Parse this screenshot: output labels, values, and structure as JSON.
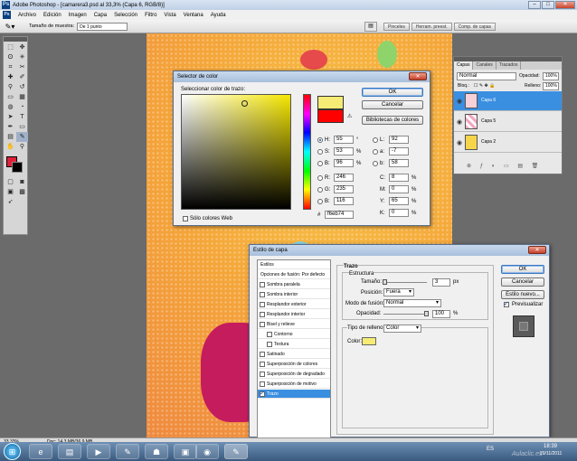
{
  "window": {
    "title": "Adobe Photoshop - [camarera3.psd al 33,3% (Capa 6, RGB/8)]",
    "app_icon_letters": "Ps"
  },
  "menu": [
    "Archivo",
    "Edición",
    "Imagen",
    "Capa",
    "Selección",
    "Filtro",
    "Vista",
    "Ventana",
    "Ayuda"
  ],
  "options_bar": {
    "sample_label": "Tamaño de muestra:",
    "sample_value": "De 1 punto",
    "palette_tabs": [
      "Pinceles",
      "Herram. preest.",
      "Comp. de capas"
    ]
  },
  "color_picker": {
    "title": "Selector de color",
    "heading": "Seleccionar color de trazo:",
    "ok": "OK",
    "cancel": "Cancelar",
    "libraries": "Bibliotecas de colores",
    "web_only": "Sólo colores Web",
    "new_color": "#f6eb74",
    "old_color": "#ff0000",
    "H_label": "H:",
    "H": "55",
    "H_unit": "°",
    "S_label": "S:",
    "S": "53",
    "S_unit": "%",
    "B_label": "B:",
    "B": "96",
    "B_unit": "%",
    "R_label": "R:",
    "R": "246",
    "G_label": "G:",
    "G": "235",
    "Bb_label": "B:",
    "Bb": "116",
    "L_label": "L:",
    "L": "92",
    "a_label": "a:",
    "a": "-7",
    "b_label": "b:",
    "b": "58",
    "C_label": "C:",
    "C": "8",
    "M_label": "M:",
    "M": "0",
    "Y_label": "Y:",
    "Y": "65",
    "K_label": "K:",
    "K": "0",
    "pct": "%",
    "hash": "#",
    "hex": "f6eb74"
  },
  "layers_panel": {
    "tabs": [
      "Capas",
      "Canales",
      "Trazados"
    ],
    "blend_mode": "Normal",
    "opacity_label": "Opacidad:",
    "opacity": "100%",
    "lock_label": "Bloq.:",
    "fill_label": "Relleno:",
    "fill": "100%",
    "layers": [
      {
        "name": "Capa 6",
        "selected": true
      },
      {
        "name": "Capa 5",
        "selected": false
      },
      {
        "name": "Capa 2",
        "selected": false
      }
    ]
  },
  "layer_style": {
    "title": "Estilo de capa",
    "list": [
      {
        "label": "Estilos",
        "checkbox": false,
        "checked": false,
        "selected": false
      },
      {
        "label": "Opciones de fusión: Por defecto",
        "checkbox": false,
        "checked": false,
        "selected": false
      },
      {
        "label": "Sombra paralela",
        "checkbox": true,
        "checked": false,
        "selected": false
      },
      {
        "label": "Sombra interior",
        "checkbox": true,
        "checked": false,
        "selected": false
      },
      {
        "label": "Resplandor exterior",
        "checkbox": true,
        "checked": false,
        "selected": false
      },
      {
        "label": "Resplandor interior",
        "checkbox": true,
        "checked": false,
        "selected": false
      },
      {
        "label": "Bisel y relieve",
        "checkbox": true,
        "checked": false,
        "selected": false
      },
      {
        "label": "Contorno",
        "checkbox": true,
        "checked": false,
        "selected": false
      },
      {
        "label": "Textura",
        "checkbox": true,
        "checked": false,
        "selected": false
      },
      {
        "label": "Satinado",
        "checkbox": true,
        "checked": false,
        "selected": false
      },
      {
        "label": "Superposición de colores",
        "checkbox": true,
        "checked": false,
        "selected": false
      },
      {
        "label": "Superposición de degradado",
        "checkbox": true,
        "checked": false,
        "selected": false
      },
      {
        "label": "Superposición de motivo",
        "checkbox": true,
        "checked": false,
        "selected": false
      },
      {
        "label": "Trazo",
        "checkbox": true,
        "checked": true,
        "selected": true
      }
    ],
    "group_title": "Trazo",
    "structure_title": "Estructura",
    "size_label": "Tamaño:",
    "size_value": "3",
    "size_unit": "px",
    "position_label": "Posición:",
    "position_value": "Fuera",
    "blend_label": "Modo de fusión:",
    "blend_value": "Normal",
    "opacity_label": "Opacidad:",
    "opacity_value": "100",
    "opacity_unit": "%",
    "fill_type_label": "Tipo de relleno:",
    "fill_type_value": "Color",
    "color_label": "Color:",
    "stroke_color": "#f6eb74",
    "ok": "OK",
    "cancel": "Cancelar",
    "new_style": "Estilo nuevo...",
    "preview": "Previsualizar"
  },
  "status": {
    "zoom": "33,33%",
    "doc": "Doc: 14,3 MB/36,9 MB"
  },
  "taskbar": {
    "lang": "ES",
    "time": "18:39",
    "date": "29/11/2011",
    "watermark": "Aulaclic.es"
  }
}
